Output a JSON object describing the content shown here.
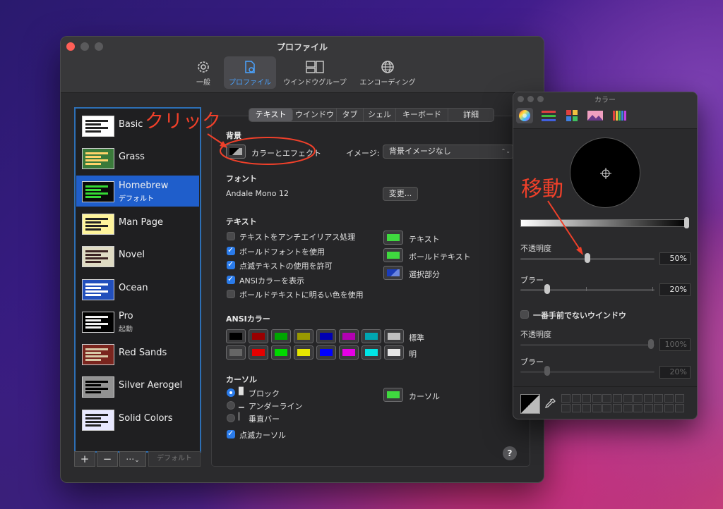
{
  "window": {
    "title": "プロファイル",
    "toolbar": [
      {
        "label": "一般",
        "icon": "gear-icon"
      },
      {
        "label": "プロファイル",
        "icon": "profile-icon",
        "active": true
      },
      {
        "label": "ウインドウグループ",
        "icon": "window-group-icon"
      },
      {
        "label": "エンコーディング",
        "icon": "globe-icon"
      }
    ]
  },
  "profiles": [
    {
      "name": "Basic",
      "sub": "",
      "bg": "#ffffff",
      "fg": "#222222"
    },
    {
      "name": "Grass",
      "sub": "",
      "bg": "#3a7a3a",
      "fg": "#ffd36a"
    },
    {
      "name": "Homebrew",
      "sub": "デフォルト",
      "bg": "#0b0b0b",
      "fg": "#35d935",
      "selected": true
    },
    {
      "name": "Man Page",
      "sub": "",
      "bg": "#fef49c",
      "fg": "#222222"
    },
    {
      "name": "Novel",
      "sub": "",
      "bg": "#dfdbc3",
      "fg": "#3b2322"
    },
    {
      "name": "Ocean",
      "sub": "",
      "bg": "#224fbc",
      "fg": "#ffffff"
    },
    {
      "name": "Pro",
      "sub": "起動",
      "bg": "#000000",
      "fg": "#f2f2f2"
    },
    {
      "name": "Red Sands",
      "sub": "",
      "bg": "#7a251e",
      "fg": "#d7c9a7"
    },
    {
      "name": "Silver Aerogel",
      "sub": "",
      "bg": "#929292",
      "fg": "#000000"
    },
    {
      "name": "Solid Colors",
      "sub": "",
      "bg": "#e8e8ff",
      "fg": "#222222"
    }
  ],
  "list_buttons": {
    "add": "+",
    "remove": "−",
    "more": "⋯",
    "chevron": "⌄",
    "default": "デフォルト"
  },
  "tabs": [
    "テキスト",
    "ウインドウ",
    "タブ",
    "シェル",
    "キーボード",
    "詳細"
  ],
  "background": {
    "heading": "背景",
    "color_effect": "カラーとエフェクト",
    "image_label": "イメージ:",
    "image_value": "背景イメージなし",
    "updown": "⌃⌄"
  },
  "font": {
    "heading": "フォント",
    "value": "Andale Mono 12",
    "change": "変更..."
  },
  "text": {
    "heading": "テキスト",
    "options": [
      {
        "label": "テキストをアンチエイリアス処理",
        "checked": false
      },
      {
        "label": "ボールドフォントを使用",
        "checked": true
      },
      {
        "label": "点滅テキストの使用を許可",
        "checked": true
      },
      {
        "label": "ANSIカラーを表示",
        "checked": true
      },
      {
        "label": "ボールドテキストに明るい色を使用",
        "checked": false
      }
    ],
    "colors": [
      {
        "label": "テキスト",
        "color": "#3fd93f"
      },
      {
        "label": "ボールドテキスト",
        "color": "#3fd93f"
      },
      {
        "label": "選択部分",
        "color": "#1a3cba"
      }
    ]
  },
  "ansi": {
    "heading": "ANSIカラー",
    "normal_label": "標準",
    "bright_label": "明",
    "normal": [
      "#000000",
      "#990000",
      "#00a600",
      "#999900",
      "#0000b2",
      "#b200b2",
      "#00a6b2",
      "#bfbfbf"
    ],
    "bright": [
      "#666666",
      "#e50000",
      "#00d900",
      "#e5e500",
      "#0000ff",
      "#e500e5",
      "#00e5e5",
      "#e5e5e5"
    ]
  },
  "cursor": {
    "heading": "カーソル",
    "options": [
      {
        "glyph": "▉",
        "label": "ブロック",
        "selected": true
      },
      {
        "glyph": "▁",
        "label": "アンダーライン",
        "selected": false
      },
      {
        "glyph": "▏",
        "label": "垂直バー",
        "selected": false
      }
    ],
    "blink_label": "点滅カーソル",
    "color_label": "カーソル",
    "color": "#3fd93f"
  },
  "help": "?",
  "color_panel": {
    "title": "カラー",
    "opacity_label": "不透明度",
    "opacity_value": "50%",
    "opacity": 0.5,
    "blur_label": "ブラー",
    "blur_value": "20%",
    "blur": 0.2,
    "inactive_label": "一番手前でないウインドウ",
    "inactive_opacity_label": "不透明度",
    "inactive_opacity_value": "100%",
    "inactive_blur_label": "ブラー",
    "inactive_blur_value": "20%"
  },
  "annotations": {
    "click": "クリック",
    "move": "移動"
  }
}
